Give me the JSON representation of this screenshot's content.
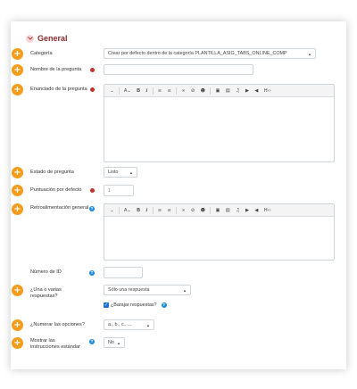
{
  "section": {
    "title": "General"
  },
  "fields": {
    "categoria": {
      "label": "Categoría",
      "value": "Crear por defecto dentro de la categoría PLANTILLA_ASIG_TABS_ONLINE_COMP"
    },
    "nombre": {
      "label": "Nombre de la pregunta",
      "value": ""
    },
    "enunciado": {
      "label": "Enunciado de la pregunta"
    },
    "estado": {
      "label": "Estado de pregunta",
      "value": "Listo"
    },
    "puntuacion": {
      "label": "Puntuación por defecto",
      "value": "1"
    },
    "retro": {
      "label": "Retroalimentación general"
    },
    "numero_id": {
      "label": "Número de ID",
      "value": ""
    },
    "respuestas": {
      "label": "¿Una o varias respuestas?",
      "value": "Sólo una respuesta"
    },
    "barajar": {
      "label": "¿Barajar respuestas?"
    },
    "numerar": {
      "label": "¿Numerar las opciones?",
      "value": "a., b., c., ..."
    },
    "instrucciones": {
      "label": "Mostrar las instrucciones estándar",
      "value": "No"
    }
  },
  "toolbar": {
    "paragraph": "⌵",
    "font": "A⌵",
    "bold": "B",
    "italic": "I",
    "ul": "☰",
    "ol": "☰",
    "link": "🔗",
    "unlink": "⛓",
    "emoji": "☺",
    "image": "▣",
    "file": "▤",
    "mic": "♩",
    "video": "▶",
    "media": "◀",
    "html": "H‹›"
  },
  "colors": {
    "accent": "#f59c1a",
    "required": "#c9302c",
    "help": "#1f8dd6",
    "title": "#8a2a2a"
  },
  "icons": {
    "expand": "chevron-down-icon",
    "plus": "plus-icon",
    "required": "exclamation-icon",
    "help": "question-icon"
  }
}
